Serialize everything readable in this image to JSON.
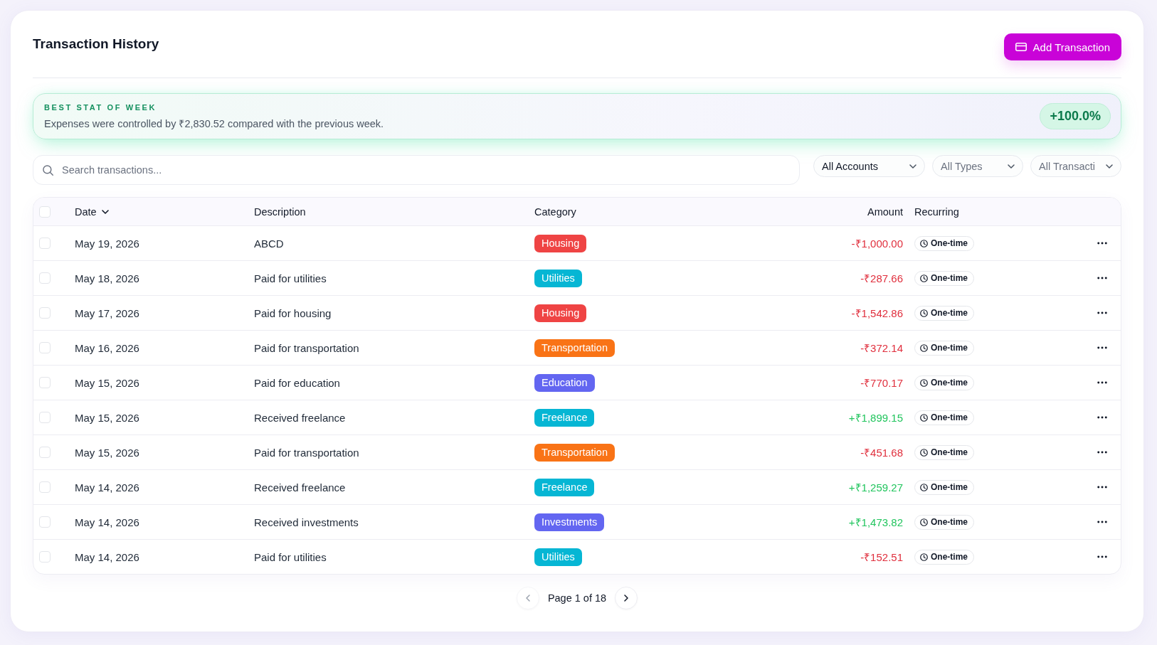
{
  "header": {
    "title": "Transaction History",
    "add_button": "Add Transaction"
  },
  "stat_banner": {
    "label": "BEST STAT OF WEEK",
    "message": "Expenses were controlled by ₹2,830.52 compared with the previous week.",
    "change": "+100.0%"
  },
  "search": {
    "placeholder": "Search transactions..."
  },
  "filters": [
    {
      "label": "All Accounts",
      "dimmed": false
    },
    {
      "label": "All Types",
      "dimmed": true
    },
    {
      "label": "All Transacti",
      "dimmed": true
    }
  ],
  "table": {
    "select_all": {
      "checked": false
    },
    "columns": [
      {
        "label": "Date",
        "sorted": true
      },
      {
        "label": "Description",
        "sorted": false
      },
      {
        "label": "Category",
        "sorted": false
      },
      {
        "label": "Amount",
        "sorted": false
      },
      {
        "label": "Recurring",
        "sorted": false
      }
    ],
    "rows": [
      {
        "checked": false,
        "date": "May 19, 2026",
        "description": "ABCD",
        "category": {
          "label": "Housing",
          "color": "#ef4444"
        },
        "amount": {
          "text": "-₹1,000.00",
          "kind": "expense"
        },
        "recurring": "One-time"
      },
      {
        "checked": false,
        "date": "May 18, 2026",
        "description": "Paid for utilities",
        "category": {
          "label": "Utilities",
          "color": "#06b6d4"
        },
        "amount": {
          "text": "-₹287.66",
          "kind": "expense"
        },
        "recurring": "One-time"
      },
      {
        "checked": false,
        "date": "May 17, 2026",
        "description": "Paid for housing",
        "category": {
          "label": "Housing",
          "color": "#ef4444"
        },
        "amount": {
          "text": "-₹1,542.86",
          "kind": "expense"
        },
        "recurring": "One-time"
      },
      {
        "checked": false,
        "date": "May 16, 2026",
        "description": "Paid for transportation",
        "category": {
          "label": "Transportation",
          "color": "#f97316"
        },
        "amount": {
          "text": "-₹372.14",
          "kind": "expense"
        },
        "recurring": "One-time"
      },
      {
        "checked": false,
        "date": "May 15, 2026",
        "description": "Paid for education",
        "category": {
          "label": "Education",
          "color": "#6366f1"
        },
        "amount": {
          "text": "-₹770.17",
          "kind": "expense"
        },
        "recurring": "One-time"
      },
      {
        "checked": false,
        "date": "May 15, 2026",
        "description": "Received freelance",
        "category": {
          "label": "Freelance",
          "color": "#06b6d4"
        },
        "amount": {
          "text": "+₹1,899.15",
          "kind": "income"
        },
        "recurring": "One-time"
      },
      {
        "checked": false,
        "date": "May 15, 2026",
        "description": "Paid for transportation",
        "category": {
          "label": "Transportation",
          "color": "#f97316"
        },
        "amount": {
          "text": "-₹451.68",
          "kind": "expense"
        },
        "recurring": "One-time"
      },
      {
        "checked": false,
        "date": "May 14, 2026",
        "description": "Received freelance",
        "category": {
          "label": "Freelance",
          "color": "#06b6d4"
        },
        "amount": {
          "text": "+₹1,259.27",
          "kind": "income"
        },
        "recurring": "One-time"
      },
      {
        "checked": false,
        "date": "May 14, 2026",
        "description": "Received investments",
        "category": {
          "label": "Investments",
          "color": "#6366f1"
        },
        "amount": {
          "text": "+₹1,473.82",
          "kind": "income"
        },
        "recurring": "One-time"
      },
      {
        "checked": false,
        "date": "May 14, 2026",
        "description": "Paid for utilities",
        "category": {
          "label": "Utilities",
          "color": "#06b6d4"
        },
        "amount": {
          "text": "-₹152.51",
          "kind": "expense"
        },
        "recurring": "One-time"
      }
    ]
  },
  "pagination": {
    "label": "Page 1 of 18",
    "prev_disabled": true,
    "next_disabled": false
  }
}
